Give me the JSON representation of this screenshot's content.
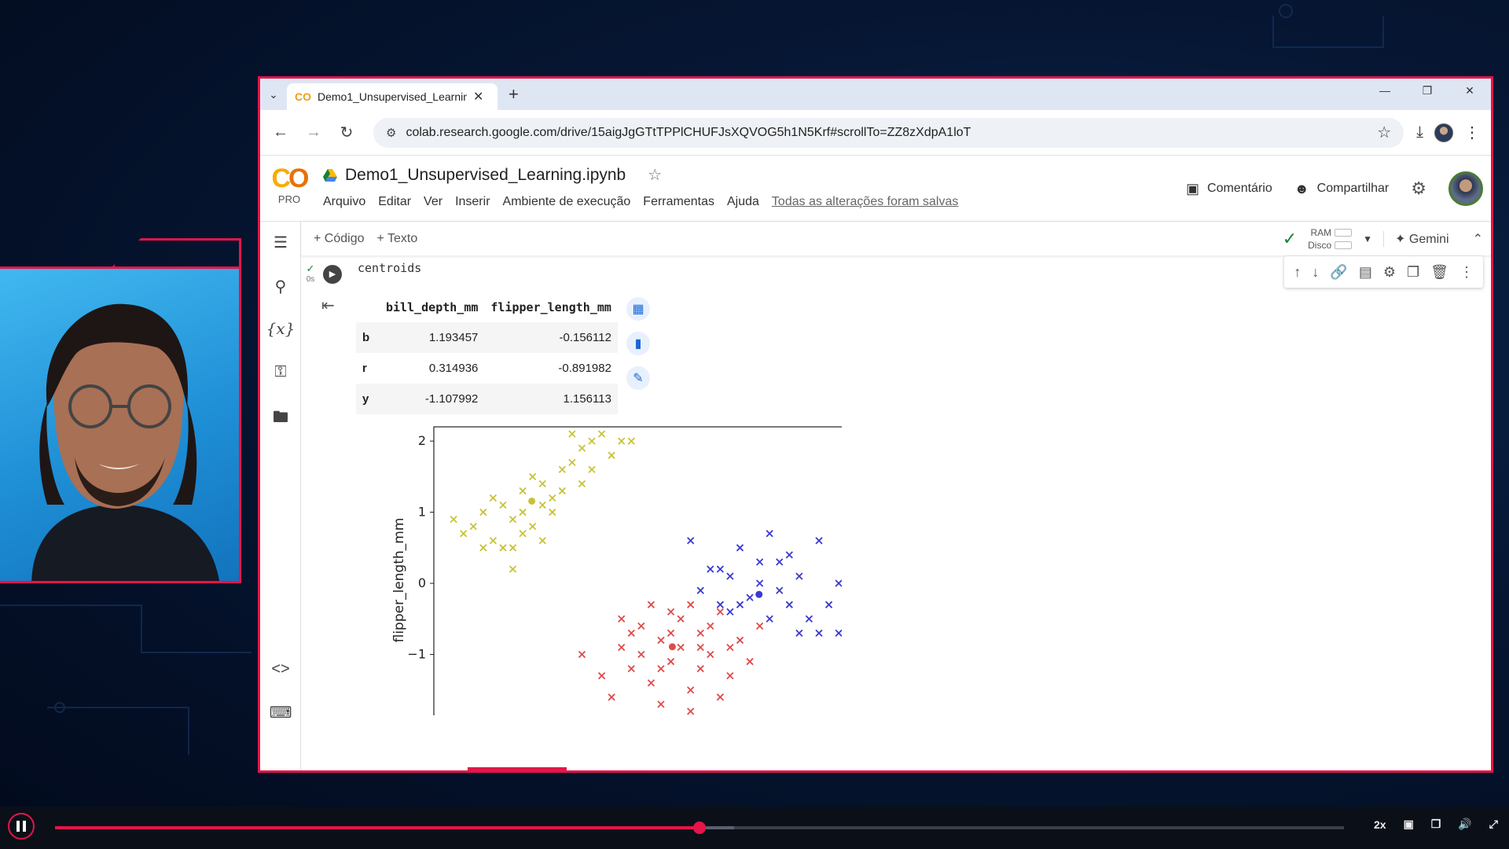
{
  "browser": {
    "tab_title": "Demo1_Unsupervised_Learning",
    "tab_logo": "CO",
    "url": "colab.research.google.com/drive/15aigJgGTtTPPlCHUFJsXQVOG5h1N5Krf#scrollTo=ZZ8zXdpA1loT"
  },
  "colab": {
    "logo_pro": "PRO",
    "notebook_name": "Demo1_Unsupervised_Learning.ipynb",
    "menu": [
      "Arquivo",
      "Editar",
      "Ver",
      "Inserir",
      "Ambiente de execução",
      "Ferramentas",
      "Ajuda"
    ],
    "saved_status": "Todas as alterações foram salvas",
    "comment_label": "Comentário",
    "share_label": "Compartilhar",
    "add_code": "+ Código",
    "add_text": "+ Texto",
    "ram_label": "RAM",
    "disk_label": "Disco",
    "gemini_label": "Gemini"
  },
  "cell": {
    "exec_time": "0s",
    "code": "centroids"
  },
  "dataframe": {
    "columns": [
      "bill_depth_mm",
      "flipper_length_mm"
    ],
    "rows": [
      {
        "index": "b",
        "bill_depth_mm": "1.193457",
        "flipper_length_mm": "-0.156112"
      },
      {
        "index": "r",
        "bill_depth_mm": "0.314936",
        "flipper_length_mm": "-0.891982"
      },
      {
        "index": "y",
        "bill_depth_mm": "-1.107992",
        "flipper_length_mm": "1.156113"
      }
    ]
  },
  "chart_data": {
    "type": "scatter",
    "ylabel": "flipper_length_mm",
    "xlabel": "",
    "y_ticks": [
      "2",
      "1",
      "0",
      "−1",
      "−2"
    ],
    "ylim": [
      -2,
      2.2
    ],
    "series": [
      {
        "color": "#c8c23a",
        "centroid": [
          -1.108,
          1.156
        ],
        "points": [
          [
            -1.9,
            0.9
          ],
          [
            -1.8,
            0.7
          ],
          [
            -1.7,
            0.8
          ],
          [
            -1.6,
            1.0
          ],
          [
            -1.5,
            0.6
          ],
          [
            -1.4,
            1.1
          ],
          [
            -1.3,
            0.9
          ],
          [
            -1.2,
            1.3
          ],
          [
            -1.1,
            0.8
          ],
          [
            -1.0,
            1.4
          ],
          [
            -0.9,
            1.2
          ],
          [
            -0.8,
            1.6
          ],
          [
            -0.7,
            1.7
          ],
          [
            -0.6,
            1.9
          ],
          [
            -0.5,
            2.0
          ],
          [
            -0.4,
            2.1
          ],
          [
            -0.3,
            1.8
          ],
          [
            -1.5,
            1.2
          ],
          [
            -1.2,
            1.0
          ],
          [
            -1.0,
            0.6
          ],
          [
            -0.9,
            1.0
          ],
          [
            -1.3,
            0.5
          ],
          [
            -1.6,
            0.5
          ],
          [
            -1.4,
            0.5
          ],
          [
            -1.1,
            1.5
          ],
          [
            -0.8,
            1.3
          ],
          [
            -0.6,
            1.4
          ],
          [
            -0.5,
            1.6
          ],
          [
            -0.7,
            2.1
          ],
          [
            -1.3,
            0.2
          ],
          [
            -0.2,
            2.0
          ],
          [
            -0.1,
            2.0
          ],
          [
            -1.0,
            1.1
          ],
          [
            -1.2,
            0.7
          ]
        ]
      },
      {
        "color": "#e04a4a",
        "centroid": [
          0.315,
          -0.892
        ],
        "points": [
          [
            -0.6,
            -1.0
          ],
          [
            -0.4,
            -1.3
          ],
          [
            -0.3,
            -1.6
          ],
          [
            -0.2,
            -0.9
          ],
          [
            -0.1,
            -1.2
          ],
          [
            0.0,
            -0.6
          ],
          [
            0.1,
            -1.4
          ],
          [
            0.2,
            -0.8
          ],
          [
            0.3,
            -1.1
          ],
          [
            0.4,
            -0.5
          ],
          [
            0.5,
            -1.5
          ],
          [
            0.6,
            -0.7
          ],
          [
            0.7,
            -1.0
          ],
          [
            0.8,
            -0.4
          ],
          [
            0.9,
            -1.3
          ],
          [
            1.0,
            -0.8
          ],
          [
            1.1,
            -1.1
          ],
          [
            1.2,
            -0.6
          ],
          [
            0.0,
            -1.0
          ],
          [
            0.2,
            -1.2
          ],
          [
            0.4,
            -0.9
          ],
          [
            0.6,
            -1.2
          ],
          [
            -0.1,
            -0.7
          ],
          [
            0.1,
            -0.3
          ],
          [
            0.3,
            -0.4
          ],
          [
            0.5,
            -0.3
          ],
          [
            0.7,
            -0.6
          ],
          [
            0.9,
            -0.9
          ],
          [
            0.2,
            -1.7
          ],
          [
            0.5,
            -1.8
          ],
          [
            0.8,
            -1.6
          ],
          [
            -0.2,
            -0.5
          ],
          [
            0.3,
            -0.7
          ],
          [
            0.6,
            -0.9
          ]
        ]
      },
      {
        "color": "#3a3ad0",
        "centroid": [
          1.193,
          -0.156
        ],
        "points": [
          [
            0.5,
            0.6
          ],
          [
            0.7,
            0.2
          ],
          [
            0.8,
            -0.3
          ],
          [
            0.9,
            0.1
          ],
          [
            1.0,
            0.5
          ],
          [
            1.1,
            -0.2
          ],
          [
            1.2,
            0.3
          ],
          [
            1.3,
            0.7
          ],
          [
            1.4,
            -0.1
          ],
          [
            1.5,
            0.4
          ],
          [
            1.6,
            0.1
          ],
          [
            1.7,
            -0.5
          ],
          [
            1.8,
            0.6
          ],
          [
            1.9,
            -0.3
          ],
          [
            2.0,
            0.0
          ],
          [
            2.1,
            -0.2
          ],
          [
            2.2,
            -0.5
          ],
          [
            1.0,
            -0.3
          ],
          [
            1.2,
            0.0
          ],
          [
            1.4,
            0.3
          ],
          [
            0.6,
            -0.1
          ],
          [
            0.8,
            0.2
          ],
          [
            1.6,
            -0.7
          ],
          [
            1.8,
            -0.7
          ],
          [
            2.0,
            -0.7
          ],
          [
            1.3,
            -0.5
          ],
          [
            1.5,
            -0.3
          ],
          [
            0.9,
            -0.4
          ]
        ]
      }
    ]
  },
  "player": {
    "progress": 0.5,
    "buffered": 0.527,
    "speed": "2x"
  }
}
